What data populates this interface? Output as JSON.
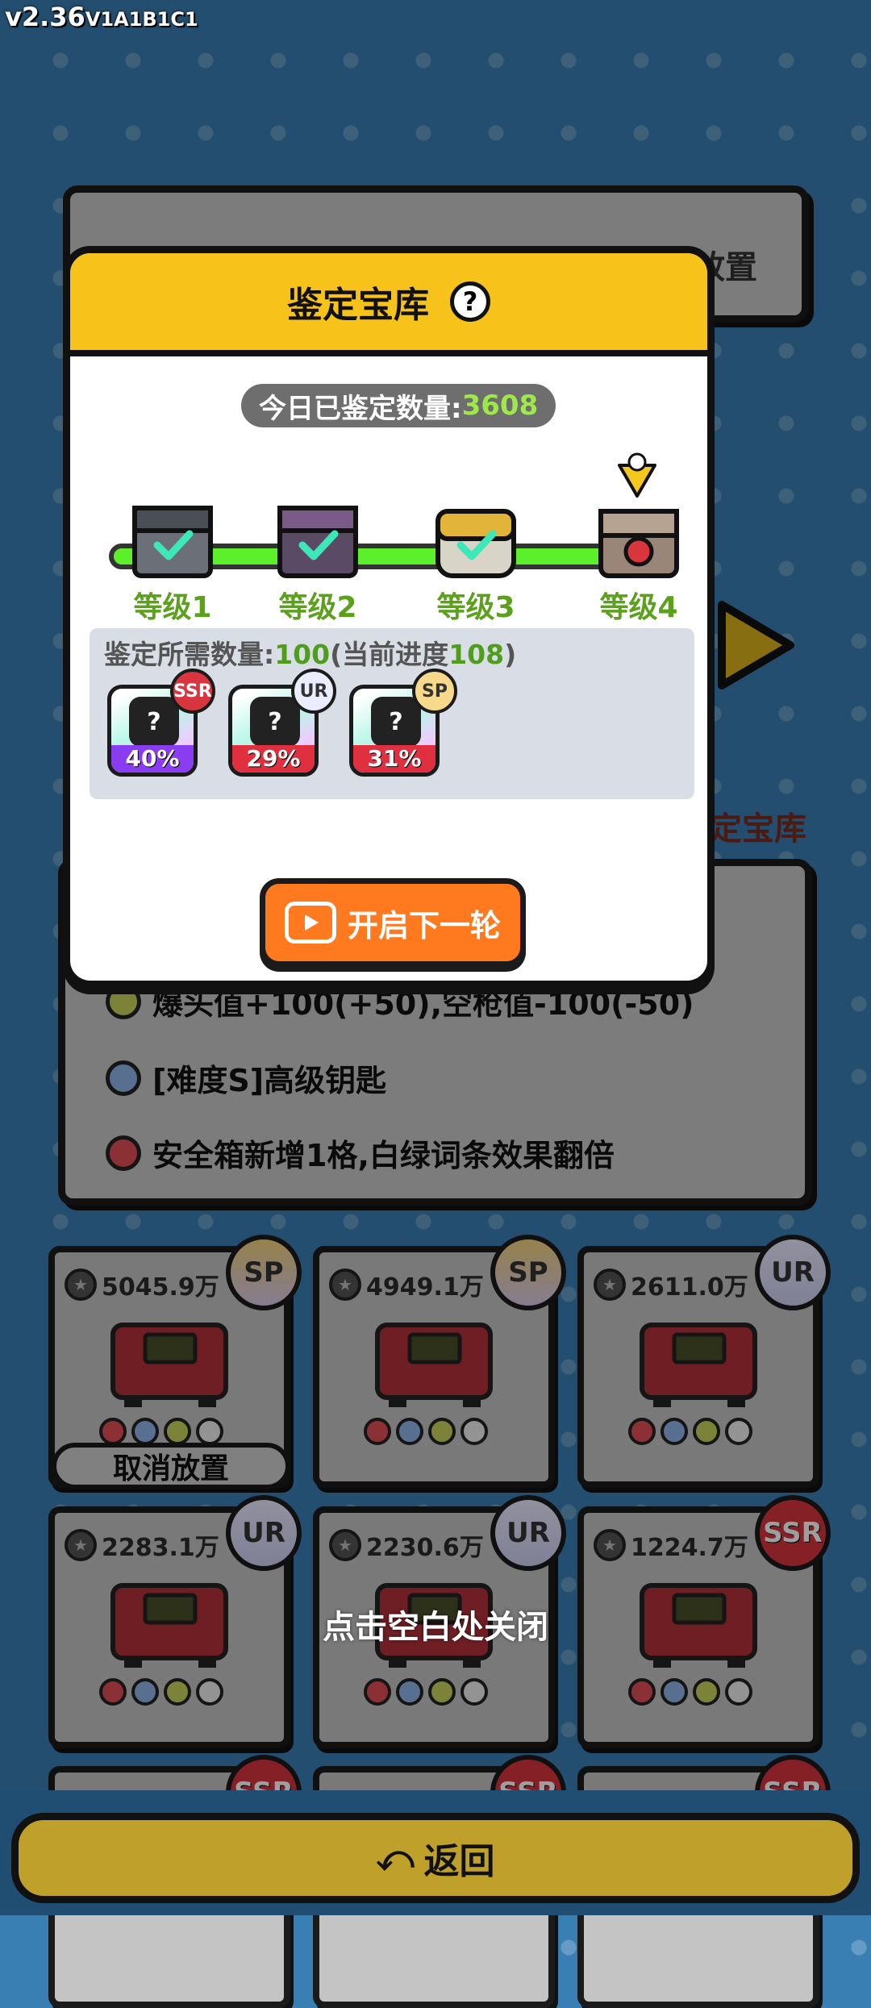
{
  "version": {
    "main": "v2.36",
    "suffix": "V1A1B1C1"
  },
  "background": {
    "top_panel_label": "放置",
    "effects": [
      {
        "text": "爆头值+100(+50),空枪值-100(-50)",
        "icon": "diamond-icon",
        "color": "#7a8a1a"
      },
      {
        "text": "[难度S]高级钥匙",
        "icon": "diamond-icon",
        "color": "#3a6fc0"
      },
      {
        "text": "安全箱新增1格,白绿词条效果翻倍",
        "icon": "pentagon-icon",
        "color": "#c0303a"
      }
    ],
    "side_label": "定宝库"
  },
  "items": [
    {
      "price": "5045.9万",
      "rarity": "SP",
      "selected": true
    },
    {
      "price": "4949.1万",
      "rarity": "SP"
    },
    {
      "price": "2611.0万",
      "rarity": "UR"
    },
    {
      "price": "2283.1万",
      "rarity": "UR"
    },
    {
      "price": "2230.6万",
      "rarity": "UR"
    },
    {
      "price": "1224.7万",
      "rarity": "SSR"
    },
    {
      "price": "",
      "rarity": "SSR"
    },
    {
      "price": "",
      "rarity": "SSR"
    },
    {
      "price": "",
      "rarity": "SSR"
    }
  ],
  "cancel_label": "取消放置",
  "modal": {
    "title": "鉴定宝库",
    "help_symbol": "?",
    "count_label": "今日已鉴定数量:",
    "count_value": "3608",
    "levels": [
      {
        "label": "等级1",
        "status": "done"
      },
      {
        "label": "等级2",
        "status": "done"
      },
      {
        "label": "等级3",
        "status": "done"
      },
      {
        "label": "等级4",
        "status": "current"
      }
    ],
    "req_label": "鉴定所需数量:",
    "req_value": "100",
    "progress_label": "(当前进度",
    "progress_value": "108",
    "progress_close": ")",
    "probabilities": [
      {
        "tag": "SSR",
        "percent": "40%",
        "bar_color": "#8a3df0",
        "tag_color": "#d8353f",
        "tag_text_color": "#ffffff"
      },
      {
        "tag": "UR",
        "percent": "29%",
        "bar_color": "#e03040",
        "tag_color": "#ececff",
        "tag_text_color": "#333333"
      },
      {
        "tag": "SP",
        "percent": "31%",
        "bar_color": "#e03040",
        "tag_color": "#f6d98a",
        "tag_text_color": "#333333"
      }
    ],
    "card_symbol": "?",
    "next_button": "开启下一轮"
  },
  "close_hint": "点击空白处关闭",
  "back_button": {
    "icon": "return-icon",
    "label": "返回",
    "symbol": "⤺"
  },
  "colors": {
    "accent_yellow": "#f7c31a",
    "button_orange": "#ff7a1f",
    "progress_green": "#5cf02a"
  }
}
